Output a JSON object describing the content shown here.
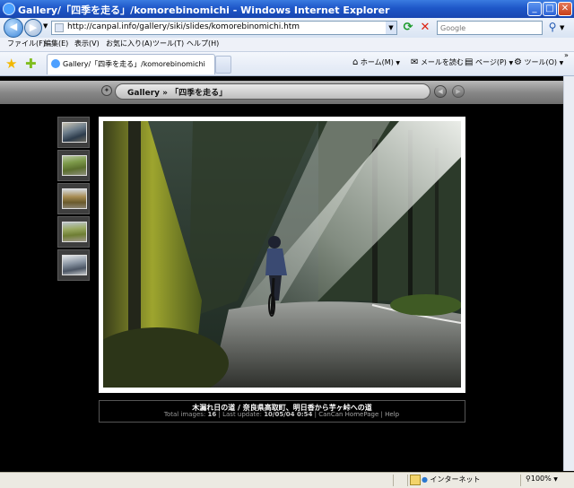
{
  "window": {
    "title": "Gallery/「四季を走る」/komorebinomichi - Windows Internet Explorer"
  },
  "address": {
    "url": "http://canpal.info/gallery/siki/slides/komorebinomichi.htm"
  },
  "search": {
    "placeholder": "Google"
  },
  "menu": [
    "ファイル(F)",
    "編集(E)",
    "表示(V)",
    "お気に入り(A)",
    "ツール(T)",
    "ヘルプ(H)"
  ],
  "tab": {
    "label": "Gallery/「四季を走る」/komorebinomichi"
  },
  "toolbar": {
    "home": "ホーム(M)",
    "mail": "メールを読む",
    "page": "ページ(P)",
    "tools": "ツール(O)"
  },
  "gallery": {
    "breadcrumb": "Gallery » 「四季を走る」",
    "caption": "木漏れ日の道 / 奈良県高取町、明日香から芋ヶ峠への道",
    "total_label": "Total images:",
    "total_value": "16",
    "update_label": "Last update:",
    "update_value": "10/05/04 0:54",
    "home_link": "CanCan HomePage",
    "help_link": "Help",
    "thumbnails": [
      "thumb-1",
      "thumb-2",
      "thumb-3",
      "thumb-4",
      "thumb-5"
    ]
  },
  "status": {
    "zone": "インターネット",
    "zoom": "100%"
  }
}
